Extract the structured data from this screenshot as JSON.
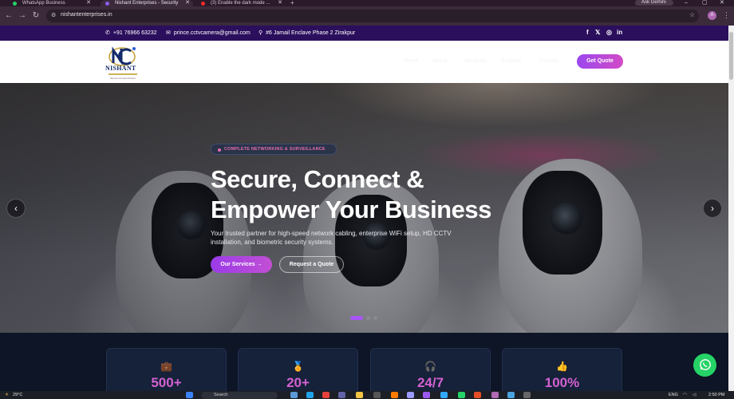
{
  "browser": {
    "tabs": [
      {
        "title": "WhatsApp Business",
        "active": false
      },
      {
        "title": "Nishant Enterprises - Security",
        "active": true
      },
      {
        "title": "(3) Enable the dark mode ...",
        "active": false
      }
    ],
    "ask_gemini": "Ask Gemini",
    "url": "nishantenterprises.in"
  },
  "topbar": {
    "phone": "+91 76966 63232",
    "email": "prince.cctvcamera@gmail.com",
    "address": "#6 Jamail Enclave Phase 2 Zirakpur",
    "socials": [
      "f",
      "𝕏",
      "◎",
      "in"
    ]
  },
  "nav": {
    "logo_text": "NISHANT",
    "logo_tagline": "Secure Connect Protect",
    "links": [
      "Home",
      "About",
      "Services",
      "Projects",
      "Contact"
    ],
    "quote_button": "Get Quote"
  },
  "hero": {
    "badge": "COMPLETE NETWORKING & SURVEILLANCE",
    "title_line1": "Secure, Connect &",
    "title_line2": "Empower Your Business",
    "lead": "Your trusted partner for high-speed network cabling, enterprise WiFi setup, HD CCTV installation, and biometric security systems.",
    "primary_button": "Our Services →",
    "secondary_button": "Request a Quote",
    "prev_arrow": "‹",
    "next_arrow": "›",
    "slide_count": 3,
    "active_slide": 1
  },
  "stats": [
    {
      "icon": "briefcase-icon",
      "value": "500+"
    },
    {
      "icon": "award-icon",
      "value": "20+"
    },
    {
      "icon": "headset-icon",
      "value": "24/7"
    },
    {
      "icon": "thumbs-up-icon",
      "value": "100%"
    }
  ],
  "taskbar": {
    "weather": "29°C",
    "search_placeholder": "Search",
    "lang": "ENG",
    "time": "2:50 PM"
  },
  "colors": {
    "topbar": "#2b0f5d",
    "accent_purple": "#9b48ef",
    "accent_pink": "#d24bc6",
    "stats_bg": "#0d1526",
    "whatsapp": "#25d366"
  }
}
